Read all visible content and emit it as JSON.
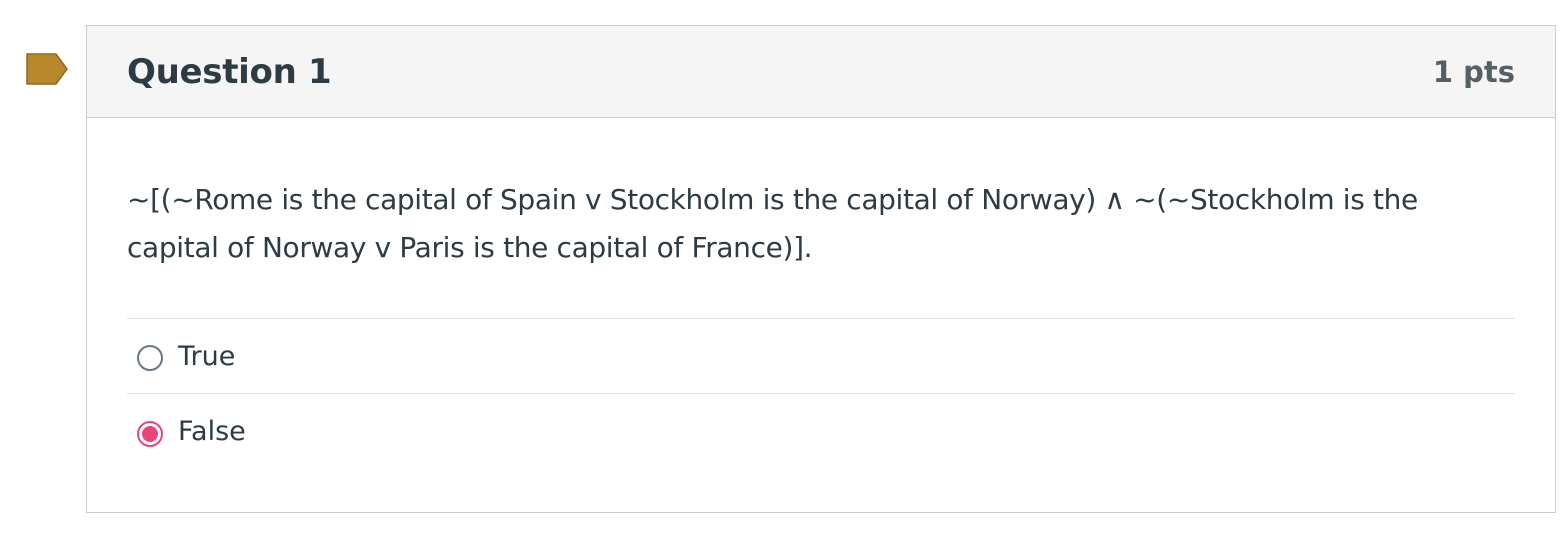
{
  "question": {
    "title": "Question 1",
    "points": "1 pts",
    "text": "~[(~Rome is the capital of Spain v Stockholm is the capital of Norway) ∧ ~(~Stockholm is the capital of Norway v Paris is the capital of France)].",
    "flag_color": "#b7892a",
    "answers": [
      {
        "label": "True",
        "selected": false
      },
      {
        "label": "False",
        "selected": true
      }
    ]
  },
  "colors": {
    "selected_radio": "#e8457e",
    "header_bg": "#f5f5f5",
    "border": "#c7cdd1"
  }
}
